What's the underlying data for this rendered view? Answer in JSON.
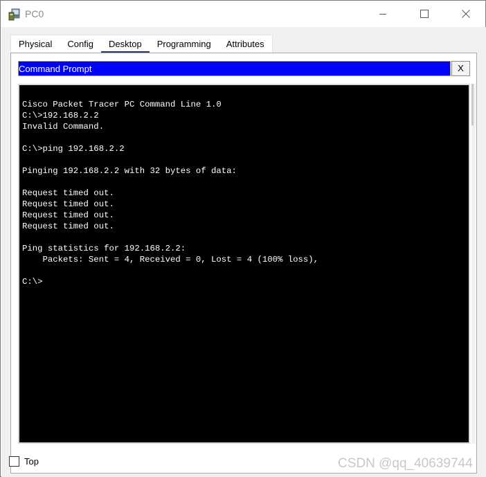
{
  "window": {
    "title": "PC0",
    "app_icon": "packet-tracer-pc-icon",
    "controls": [
      "minimize-icon",
      "maximize-icon",
      "close-icon"
    ]
  },
  "tabs": [
    {
      "label": "Physical",
      "active": false
    },
    {
      "label": "Config",
      "active": false
    },
    {
      "label": "Desktop",
      "active": true
    },
    {
      "label": "Programming",
      "active": false
    },
    {
      "label": "Attributes",
      "active": false
    }
  ],
  "command_prompt": {
    "title": "Command Prompt",
    "close_label": "X",
    "header_color": "#0000ff",
    "lines": [
      "Cisco Packet Tracer PC Command Line 1.0",
      "C:\\>192.168.2.2",
      "Invalid Command.",
      "",
      "C:\\>ping 192.168.2.2",
      "",
      "Pinging 192.168.2.2 with 32 bytes of data:",
      "",
      "Request timed out.",
      "Request timed out.",
      "Request timed out.",
      "Request timed out.",
      "",
      "Ping statistics for 192.168.2.2:",
      "    Packets: Sent = 4, Received = 0, Lost = 4 (100% loss),",
      "",
      "C:\\>"
    ]
  },
  "footer": {
    "top_label": "Top",
    "top_checked": false
  },
  "watermark": "CSDN @qq_40639744"
}
